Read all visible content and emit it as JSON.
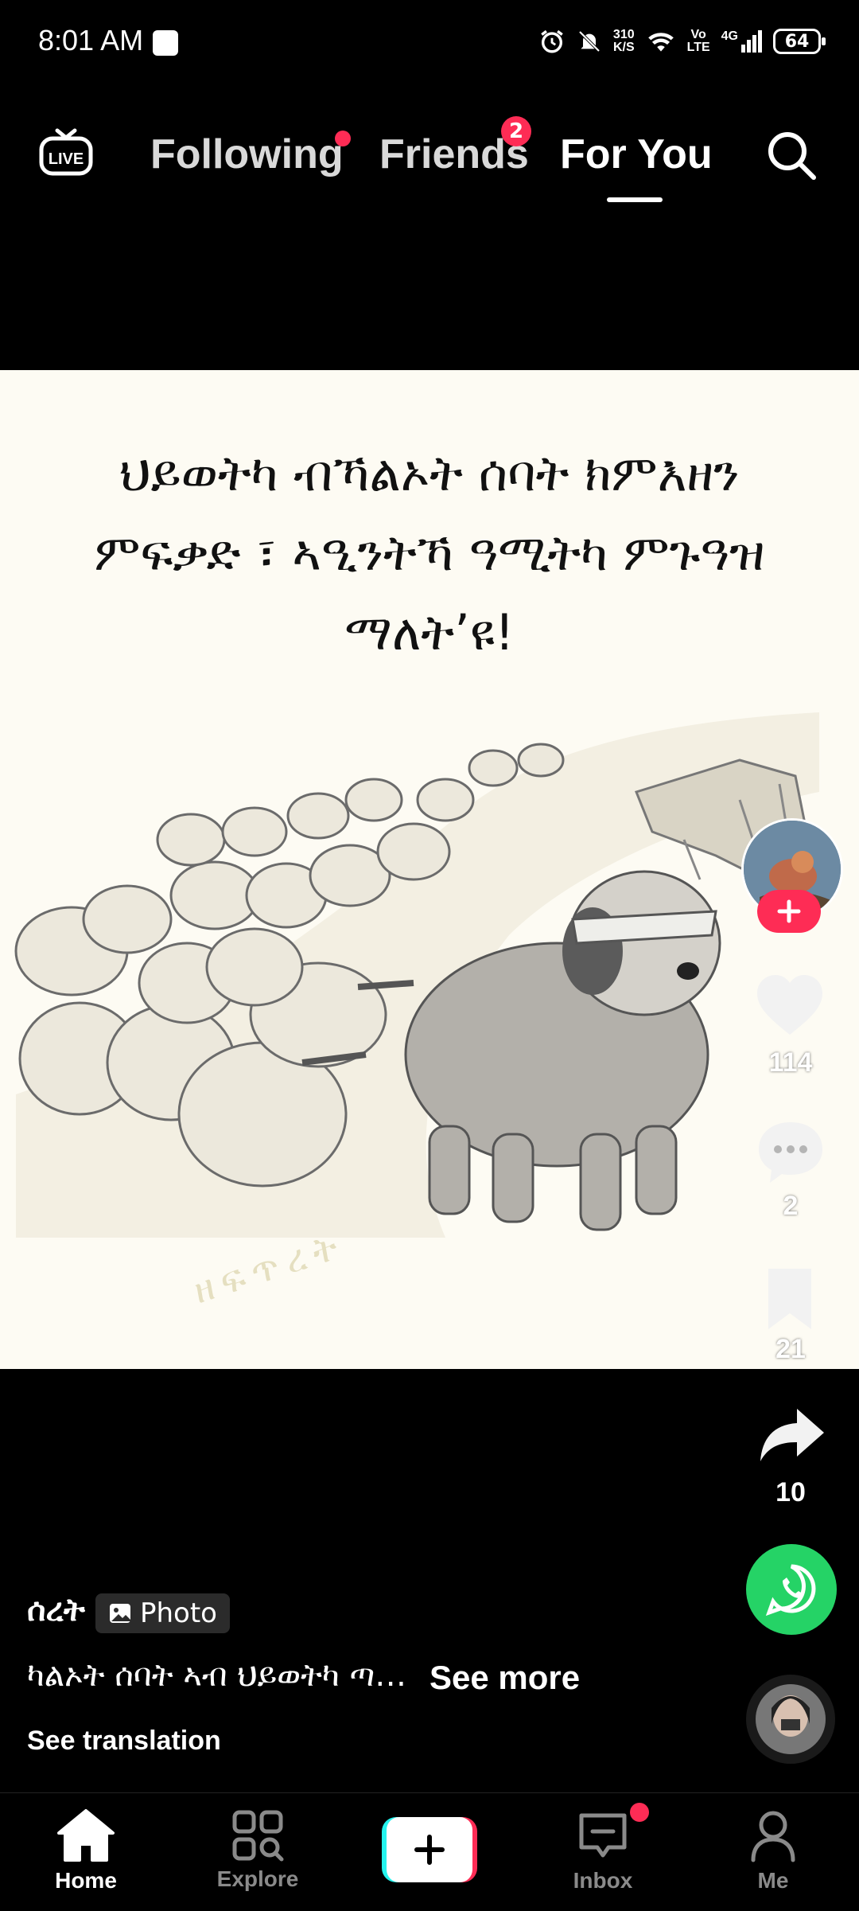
{
  "status_bar": {
    "time": "8:01 AM",
    "net_speed_top": "310",
    "net_speed_bottom": "K/S",
    "volte_top": "Vo",
    "volte_bottom": "LTE",
    "network": "4G",
    "battery": "64"
  },
  "top_nav": {
    "live_label": "LIVE",
    "tabs": [
      {
        "label": "Following"
      },
      {
        "label": "Friends",
        "badge": "2"
      },
      {
        "label": "For You"
      }
    ]
  },
  "post": {
    "image_text": [
      "ህይወትካ ብኻልኦት ሰባት ክምእዘን",
      "ምፍቃድ ፣ ኣዒንትኻ ዓሚትካ ምጉዓዝ",
      "ማለት’ዩ!"
    ],
    "watermark": "ዘፍጥረት",
    "username": "ሰረት",
    "type_tag": "Photo",
    "description": "ካልኦት ሰባት ኣብ ህይወትካ ጣ…",
    "see_more": "See more",
    "see_translation": "See translation"
  },
  "actions": {
    "likes": "114",
    "comments": "2",
    "saves": "21",
    "shares": "10"
  },
  "bottom_nav": {
    "items": [
      {
        "label": "Home"
      },
      {
        "label": "Explore"
      },
      {
        "label": "Inbox"
      },
      {
        "label": "Me"
      }
    ]
  },
  "colors": {
    "accent": "#fe2c55",
    "whatsapp": "#25d366",
    "cyan": "#25f4ee"
  }
}
